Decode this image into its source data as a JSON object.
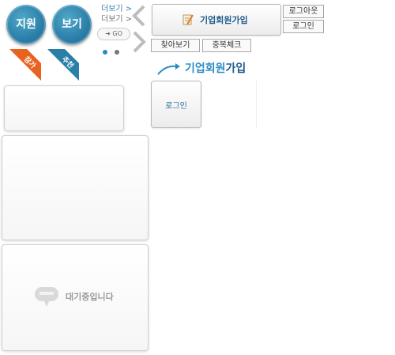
{
  "badges": {
    "apply_label": "지원",
    "view_label": "보기"
  },
  "ribbons": {
    "left_label": "참가",
    "right_label": "추천"
  },
  "more": {
    "link1": "더보기 >",
    "link2": "더보기 >",
    "go_label": "➜ GO"
  },
  "nav": {
    "join_label": "기업회원가입",
    "logout_label": "로그아웃",
    "login_label": "로그인",
    "find_label": "찾아보기",
    "duplicate_label": "중복체크"
  },
  "heading": {
    "prefix": "기업회원",
    "suffix": "가입"
  },
  "panels": {
    "login_button_label": "로그인",
    "waiting_label": "대기중입니다"
  },
  "colors": {
    "badge_blue": "#2a7ea8",
    "ribbon_orange": "#e8631f",
    "ribbon_teal": "#2a7ea8",
    "brand_blue": "#2b8cc4",
    "dark_blue": "#1f5a8c"
  }
}
